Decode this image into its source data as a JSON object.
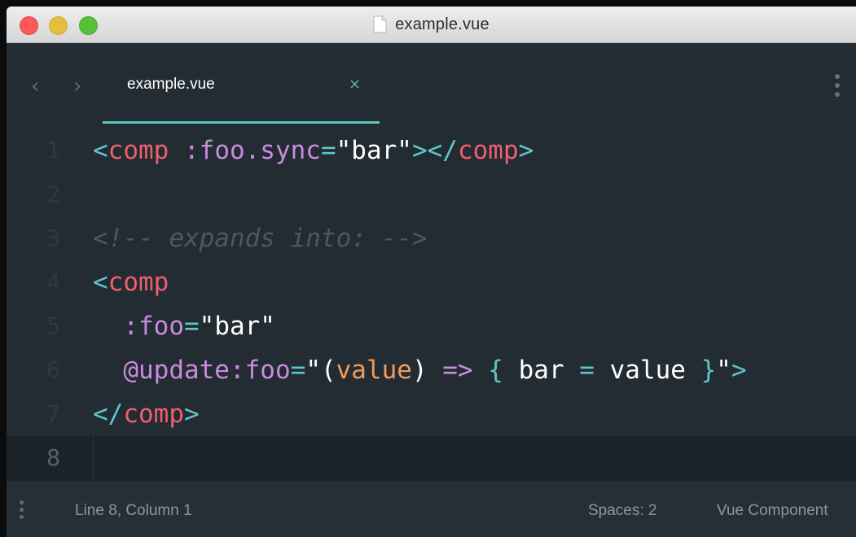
{
  "window": {
    "title": "example.vue"
  },
  "tabs": [
    {
      "label": "example.vue",
      "close": "×"
    }
  ],
  "nav": {
    "back": "‹",
    "forward": "›"
  },
  "editor": {
    "active_line": 8,
    "lines": [
      {
        "n": "1",
        "tokens": [
          {
            "t": "<",
            "c": "punct"
          },
          {
            "t": "comp",
            "c": "tag"
          },
          {
            "t": " :foo.sync",
            "c": "attr"
          },
          {
            "t": "=",
            "c": "op"
          },
          {
            "t": "\"bar\"",
            "c": "str"
          },
          {
            "t": "></",
            "c": "punct"
          },
          {
            "t": "comp",
            "c": "tag"
          },
          {
            "t": ">",
            "c": "punct"
          }
        ]
      },
      {
        "n": "2",
        "tokens": []
      },
      {
        "n": "3",
        "tokens": [
          {
            "t": "<!-- expands into: -->",
            "c": "comment"
          }
        ]
      },
      {
        "n": "4",
        "tokens": [
          {
            "t": "<",
            "c": "punct"
          },
          {
            "t": "comp",
            "c": "tag"
          }
        ]
      },
      {
        "n": "5",
        "tokens": [
          {
            "t": "  :foo",
            "c": "attr"
          },
          {
            "t": "=",
            "c": "op"
          },
          {
            "t": "\"bar\"",
            "c": "str"
          }
        ]
      },
      {
        "n": "6",
        "tokens": [
          {
            "t": "  @update:foo",
            "c": "attr"
          },
          {
            "t": "=",
            "c": "op"
          },
          {
            "t": "\"(",
            "c": "str"
          },
          {
            "t": "value",
            "c": "param"
          },
          {
            "t": ")",
            "c": "str"
          },
          {
            "t": " => ",
            "c": "arrow"
          },
          {
            "t": "{",
            "c": "op"
          },
          {
            "t": " bar ",
            "c": "str"
          },
          {
            "t": "=",
            "c": "op"
          },
          {
            "t": " value ",
            "c": "str"
          },
          {
            "t": "}",
            "c": "op"
          },
          {
            "t": "\"",
            "c": "str"
          },
          {
            "t": ">",
            "c": "punct"
          }
        ]
      },
      {
        "n": "7",
        "tokens": [
          {
            "t": "</",
            "c": "punct"
          },
          {
            "t": "comp",
            "c": "tag"
          },
          {
            "t": ">",
            "c": "punct"
          }
        ]
      },
      {
        "n": "8",
        "tokens": []
      }
    ]
  },
  "statusbar": {
    "position": "Line 8, Column 1",
    "indentation": "Spaces: 2",
    "syntax": "Vue Component"
  },
  "colors": {
    "accent": "#5fc4c0",
    "tag": "#ef5f6e",
    "attribute": "#c98be0",
    "parameter": "#f29b58",
    "background": "#232c33"
  }
}
